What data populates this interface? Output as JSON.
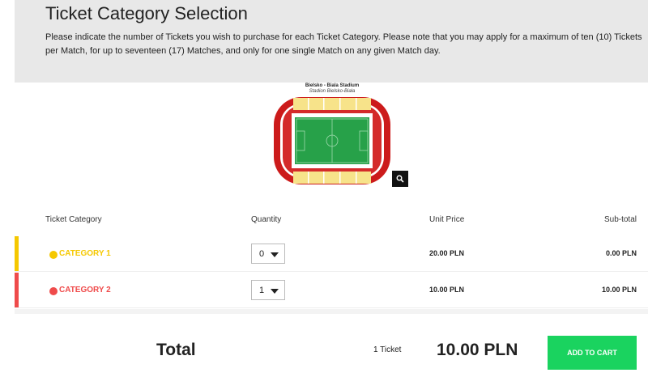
{
  "header": {
    "title": "Ticket Category Selection",
    "intro": "Please indicate the number of Tickets you wish to purchase for each Ticket Category. Please note that you may apply for a maximum of ten (10) Tickets per Match, for up to seventeen (17) Matches, and only for one single Match on any given Match day."
  },
  "stadium": {
    "name": "Bielsko - Biala Stadium",
    "subtitle": "Stadion Bielsko-Biała",
    "zoom_icon": "search-icon"
  },
  "table": {
    "headers": {
      "category": "Ticket Category",
      "quantity": "Quantity",
      "unit_price": "Unit Price",
      "subtotal": "Sub-total"
    },
    "rows": [
      {
        "category": "CATEGORY 1",
        "color": "#f5c800",
        "quantity": "0",
        "unit_price": "20.00 PLN",
        "subtotal": "0.00 PLN"
      },
      {
        "category": "CATEGORY 2",
        "color": "#ef4b4b",
        "quantity": "1",
        "unit_price": "10.00 PLN",
        "subtotal": "10.00 PLN"
      }
    ]
  },
  "summary": {
    "total_label": "Total",
    "ticket_count": "1 Ticket",
    "total_amount": "10.00 PLN",
    "add_to_cart": "ADD TO CART"
  },
  "colors": {
    "accent_green": "#1ad35f",
    "category_1": "#f5c800",
    "category_2": "#ef4b4b",
    "pitch": "#27a149"
  }
}
